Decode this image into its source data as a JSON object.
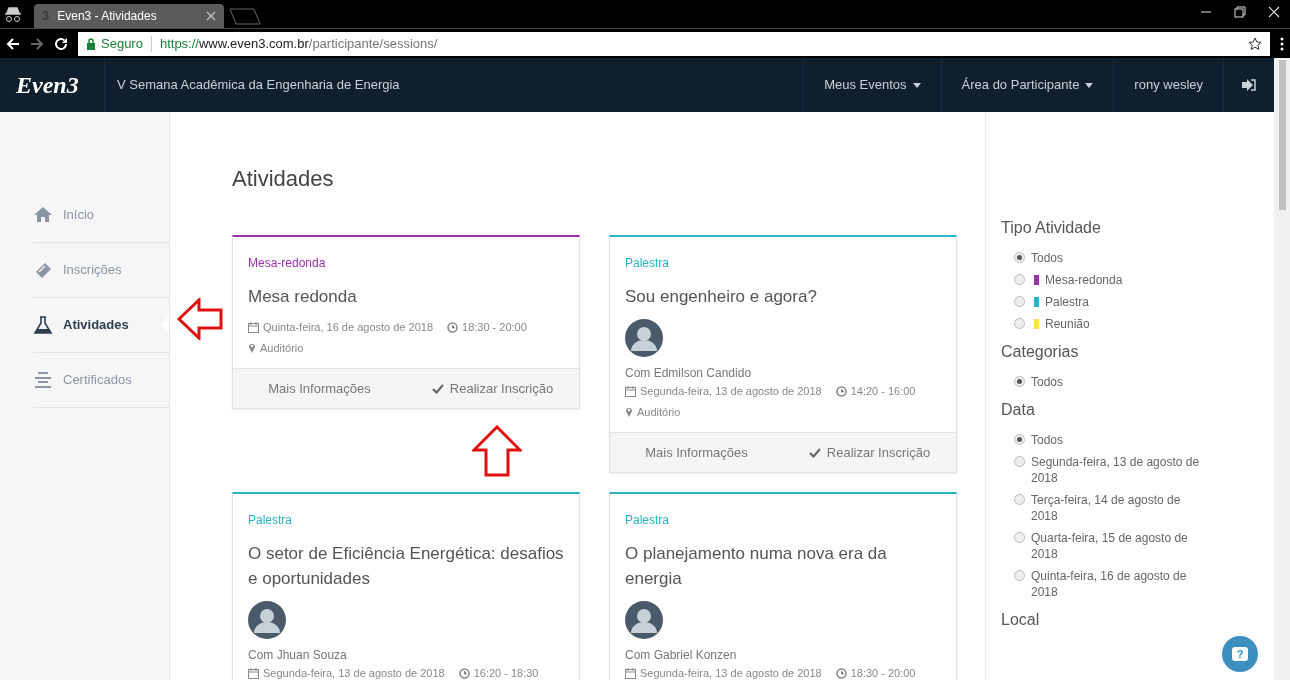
{
  "browser": {
    "tab_favicon": "3",
    "tab_title": "Even3 - Atividades",
    "secure_label": "Seguro",
    "url": {
      "scheme": "https://",
      "host": "www.even3.com.br",
      "path": "/participante/sessions/"
    }
  },
  "navbar": {
    "logo": "Even3",
    "event_title": "V Semana Acadêmica da Engenharia de Energia",
    "menus": [
      {
        "label": "Meus Eventos",
        "dropdown": true
      },
      {
        "label": "Área do Participante",
        "dropdown": true
      },
      {
        "label": "rony wesley",
        "dropdown": false
      }
    ]
  },
  "sidebar": {
    "items": [
      {
        "kind": "home",
        "label": "Início",
        "selected": false
      },
      {
        "kind": "ticket",
        "label": "Inscrições",
        "selected": false
      },
      {
        "kind": "flask",
        "label": "Atividades",
        "selected": true
      },
      {
        "kind": "certificate",
        "label": "Certificados",
        "selected": false
      }
    ]
  },
  "main": {
    "title": "Atividades",
    "cards": [
      {
        "type": "Mesa-redonda",
        "color": "#9b2fae",
        "title": "Mesa redonda",
        "date": "Quinta-feira, 16 de agosto de 2018",
        "time": "18:30 - 20:00",
        "location": "Auditório",
        "buttons": [
          "Mais Informações",
          "Realizar Inscrição"
        ]
      },
      {
        "type": "Palestra",
        "color": "#26b5c8",
        "title": "Sou engenheiro e agora?",
        "speaker": "Com Edmilson Candido",
        "date": "Segunda-feira, 13 de agosto de 2018",
        "time": "14:20 - 16:00",
        "location": "Auditório",
        "buttons": [
          "Mais Informações",
          "Realizar Inscrição"
        ]
      },
      {
        "type": "Palestra",
        "color": "#26b5c8",
        "title": "O setor de Eficiência Energética: desafios e oportunidades",
        "speaker": "Com Jhuan Souza",
        "date": "Segunda-feira, 13 de agosto de 2018",
        "time": "16:20 - 18:30"
      },
      {
        "type": "Palestra",
        "color": "#26b5c8",
        "title": "O planejamento numa nova era da energia",
        "speaker": "Com Gabriel Konzen",
        "date": "Segunda-feira, 13 de agosto de 2018",
        "time": "18:30 - 20:00"
      }
    ]
  },
  "filters": [
    {
      "title": "Tipo Atividade",
      "options": [
        {
          "label": "Todos",
          "selected": true
        },
        {
          "label": "Mesa-redonda",
          "selected": false,
          "color": "#9b2fae"
        },
        {
          "label": "Palestra",
          "selected": false,
          "color": "#26b5c8"
        },
        {
          "label": "Reunião",
          "selected": false,
          "color": "#fde24a"
        }
      ]
    },
    {
      "title": "Categorias",
      "options": [
        {
          "label": "Todos",
          "selected": true
        }
      ]
    },
    {
      "title": "Data",
      "options": [
        {
          "label": "Todos",
          "selected": true
        },
        {
          "label": "Segunda-feira, 13 de agosto de 2018",
          "selected": false
        },
        {
          "label": "Terça-feira, 14 de agosto de 2018",
          "selected": false
        },
        {
          "label": "Quarta-feira, 15 de agosto de 2018",
          "selected": false
        },
        {
          "label": "Quinta-feira, 16 de agosto de 2018",
          "selected": false
        }
      ]
    },
    {
      "title": "Local"
    }
  ],
  "help_button": "?"
}
